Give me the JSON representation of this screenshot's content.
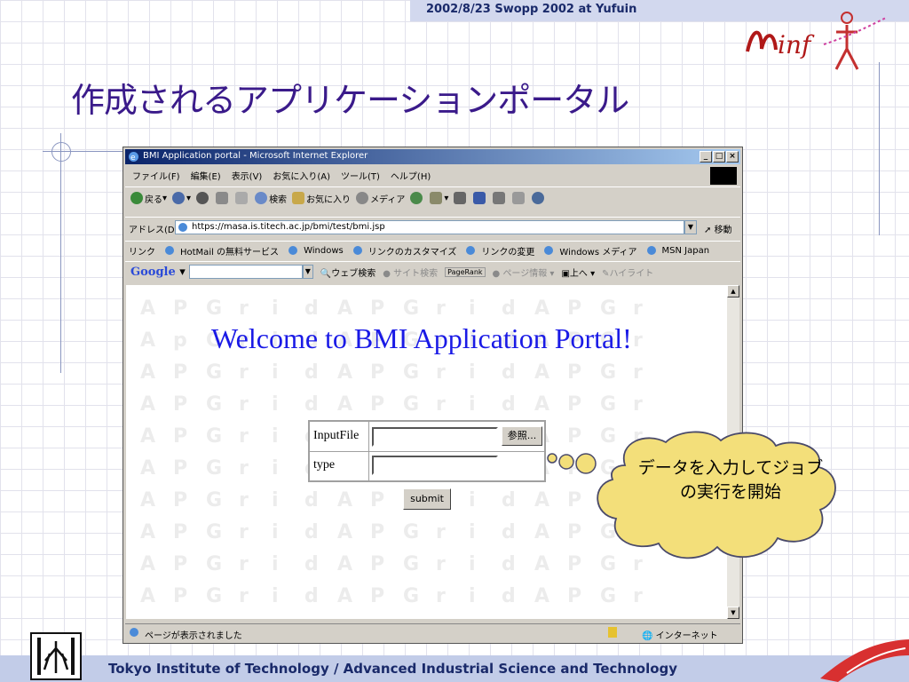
{
  "banner": {
    "text": "2002/8/23 Swopp 2002 at Yufuin"
  },
  "slide": {
    "title": "作成されるアプリケーションポータル"
  },
  "footer": {
    "text": "Tokyo Institute of Technology / Advanced Industrial Science and Technology"
  },
  "browser": {
    "title": "BMI Application portal - Microsoft Internet Explorer",
    "window_buttons": [
      "_",
      "□",
      "×"
    ],
    "menu": [
      "ファイル(F)",
      "編集(E)",
      "表示(V)",
      "お気に入り(A)",
      "ツール(T)",
      "ヘルプ(H)"
    ],
    "toolbar": {
      "back": "戻る",
      "search": "検索",
      "favorites": "お気に入り",
      "media": "メディア"
    },
    "address": {
      "label": "アドレス(D)",
      "url": "https://masa.is.titech.ac.jp/bmi/test/bmi.jsp",
      "go": "移動"
    },
    "links": {
      "label": "リンク",
      "items": [
        "HotMail の無料サービス",
        "Windows",
        "リンクのカスタマイズ",
        "リンクの変更",
        "Windows メディア",
        "MSN Japan"
      ]
    },
    "google": {
      "logo": "Google",
      "web_search": "ウェブ検索",
      "site_search": "サイト検索",
      "pagerank": "PageRank",
      "page_info": "ページ情報",
      "up": "上へ",
      "highlight": "ハイライト"
    },
    "status": {
      "text": "ページが表示されました",
      "zone": "インターネット"
    }
  },
  "page": {
    "heading": "Welcome to BMI Application Portal!",
    "form": {
      "input_file_label": "InputFile",
      "browse": "参照...",
      "type_label": "type",
      "submit": "submit"
    },
    "watermark_rows": [
      "A P G r i d A P G r i d A P G r",
      "A p G r i d A P G r i d A P G r",
      "A P G r i d A P G r i d A P G r",
      "A P G r i d A P G r i d A P G r",
      "A P G r i d A P G r i d A P G r",
      "A P G r i d A P G r i d A P G r",
      "A P G r i d A P G r i d A P G r",
      "A P G r i d A P G r i d A P G r",
      "A P G r i d A P G r i d A P G r",
      "A P G r i d A P G r i d A P G r"
    ]
  },
  "callout": {
    "text": "データを入力してジョブの実行を開始"
  },
  "colors": {
    "title": "#3a1a8a",
    "heading": "#1a1ae6",
    "callout_fill": "#f3df7a",
    "banner": "#d2d8ee"
  }
}
